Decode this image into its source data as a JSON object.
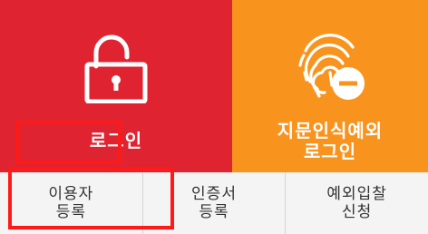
{
  "colors": {
    "login_tile": "#e02331",
    "fingerprint_tile": "#f8941e",
    "bottom_bar": "#f4f4f4",
    "highlight": "#ff1a1a"
  },
  "tiles": [
    {
      "label": "로그인",
      "icon": "unlocked-padlock-icon"
    },
    {
      "label": "지문인식예외\n로그인",
      "icon": "fingerprint-minus-icon"
    }
  ],
  "bottom_buttons": [
    {
      "label": "이용자\n등록"
    },
    {
      "label": "인증서\n등록"
    },
    {
      "label": "예외입찰\n신청"
    }
  ]
}
